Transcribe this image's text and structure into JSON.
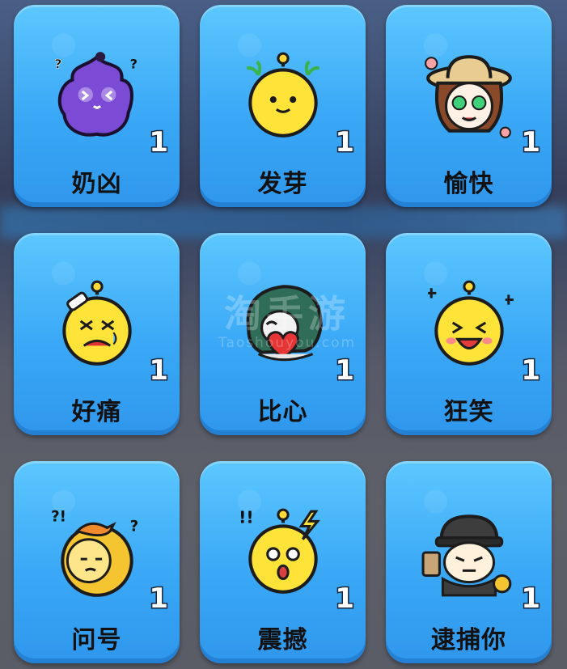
{
  "watermark": {
    "title": "淘手游",
    "url": "Taoshouyou.com"
  },
  "emotes": [
    {
      "name": "奶凶",
      "count": "1",
      "icon": "purple-flame-pout-icon"
    },
    {
      "name": "发芽",
      "count": "1",
      "icon": "sprouting-bean-icon"
    },
    {
      "name": "愉快",
      "count": "1",
      "icon": "happy-girl-hat-icon"
    },
    {
      "name": "好痛",
      "count": "1",
      "icon": "crying-bandaid-icon"
    },
    {
      "name": "比心",
      "count": "1",
      "icon": "heart-gesture-icon"
    },
    {
      "name": "狂笑",
      "count": "1",
      "icon": "laughing-bean-icon"
    },
    {
      "name": "问号",
      "count": "1",
      "icon": "question-bird-icon"
    },
    {
      "name": "震撼",
      "count": "1",
      "icon": "shocked-bean-icon"
    },
    {
      "name": "逮捕你",
      "count": "1",
      "icon": "detective-arrest-icon"
    }
  ]
}
